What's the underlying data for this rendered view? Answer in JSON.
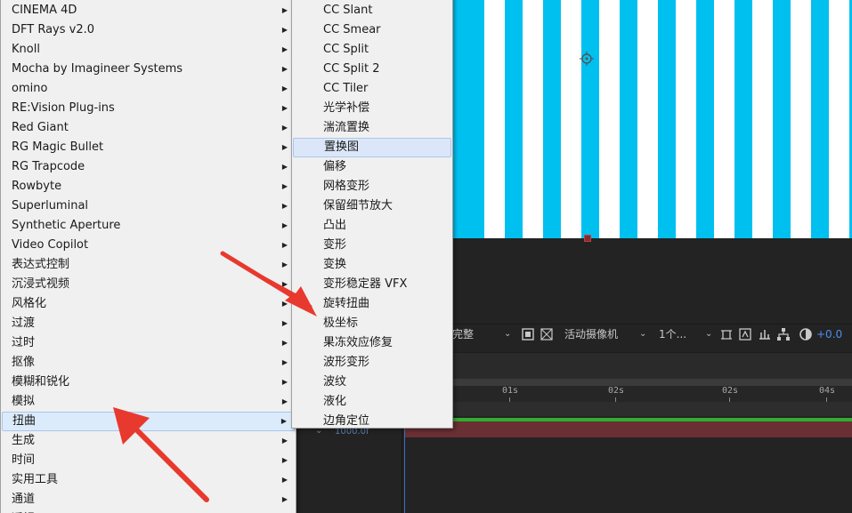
{
  "main_menu": {
    "items": [
      {
        "label": "CINEMA 4D",
        "submenu": true
      },
      {
        "label": "DFT Rays v2.0",
        "submenu": true
      },
      {
        "label": "Knoll",
        "submenu": true
      },
      {
        "label": "Mocha by Imagineer Systems",
        "submenu": true
      },
      {
        "label": "omino",
        "submenu": true
      },
      {
        "label": "RE:Vision Plug-ins",
        "submenu": true
      },
      {
        "label": "Red Giant",
        "submenu": true
      },
      {
        "label": "RG Magic Bullet",
        "submenu": true
      },
      {
        "label": "RG Trapcode",
        "submenu": true
      },
      {
        "label": "Rowbyte",
        "submenu": true
      },
      {
        "label": "Superluminal",
        "submenu": true
      },
      {
        "label": "Synthetic Aperture",
        "submenu": true
      },
      {
        "label": "Video Copilot",
        "submenu": true
      },
      {
        "label": "表达式控制",
        "submenu": true
      },
      {
        "label": "沉浸式视频",
        "submenu": true
      },
      {
        "label": "风格化",
        "submenu": true
      },
      {
        "label": "过渡",
        "submenu": true
      },
      {
        "label": "过时",
        "submenu": true
      },
      {
        "label": "抠像",
        "submenu": true
      },
      {
        "label": "模糊和锐化",
        "submenu": true
      },
      {
        "label": "模拟",
        "submenu": true
      },
      {
        "label": "扭曲",
        "submenu": true,
        "highlighted": true
      },
      {
        "label": "生成",
        "submenu": true
      },
      {
        "label": "时间",
        "submenu": true
      },
      {
        "label": "实用工具",
        "submenu": true
      },
      {
        "label": "通道",
        "submenu": true
      },
      {
        "label": "透视",
        "submenu": true
      }
    ]
  },
  "sub_menu": {
    "items": [
      {
        "label": "CC Slant"
      },
      {
        "label": "CC Smear"
      },
      {
        "label": "CC Split"
      },
      {
        "label": "CC Split 2"
      },
      {
        "label": "CC Tiler"
      },
      {
        "label": "光学补偿"
      },
      {
        "label": "湍流置换"
      },
      {
        "label": "置换图",
        "highlighted": true
      },
      {
        "label": "偏移"
      },
      {
        "label": "网格变形"
      },
      {
        "label": "保留细节放大"
      },
      {
        "label": "凸出"
      },
      {
        "label": "变形"
      },
      {
        "label": "变换"
      },
      {
        "label": "变形稳定器 VFX"
      },
      {
        "label": "旋转扭曲"
      },
      {
        "label": "极坐标"
      },
      {
        "label": "果冻效应修复"
      },
      {
        "label": "波形变形"
      },
      {
        "label": "波纹"
      },
      {
        "label": "液化"
      },
      {
        "label": "边角定位"
      }
    ]
  },
  "viewer_toolbar": {
    "resolution": "完整",
    "camera": "活动摄像机",
    "views": "1个...",
    "exposure": "+0.0"
  },
  "timeline": {
    "ruler_labels": [
      "01s",
      "02s",
      "02s",
      "04s"
    ],
    "timecode": "1000.0f"
  },
  "colors": {
    "stripe_cyan": "#00c0f0",
    "menu_bg": "#f0f0f0",
    "highlight": "#dbe7f8",
    "annotation_red": "#e8392e",
    "work_area_green": "#2fae2f",
    "layer_red": "#6a2f33"
  }
}
